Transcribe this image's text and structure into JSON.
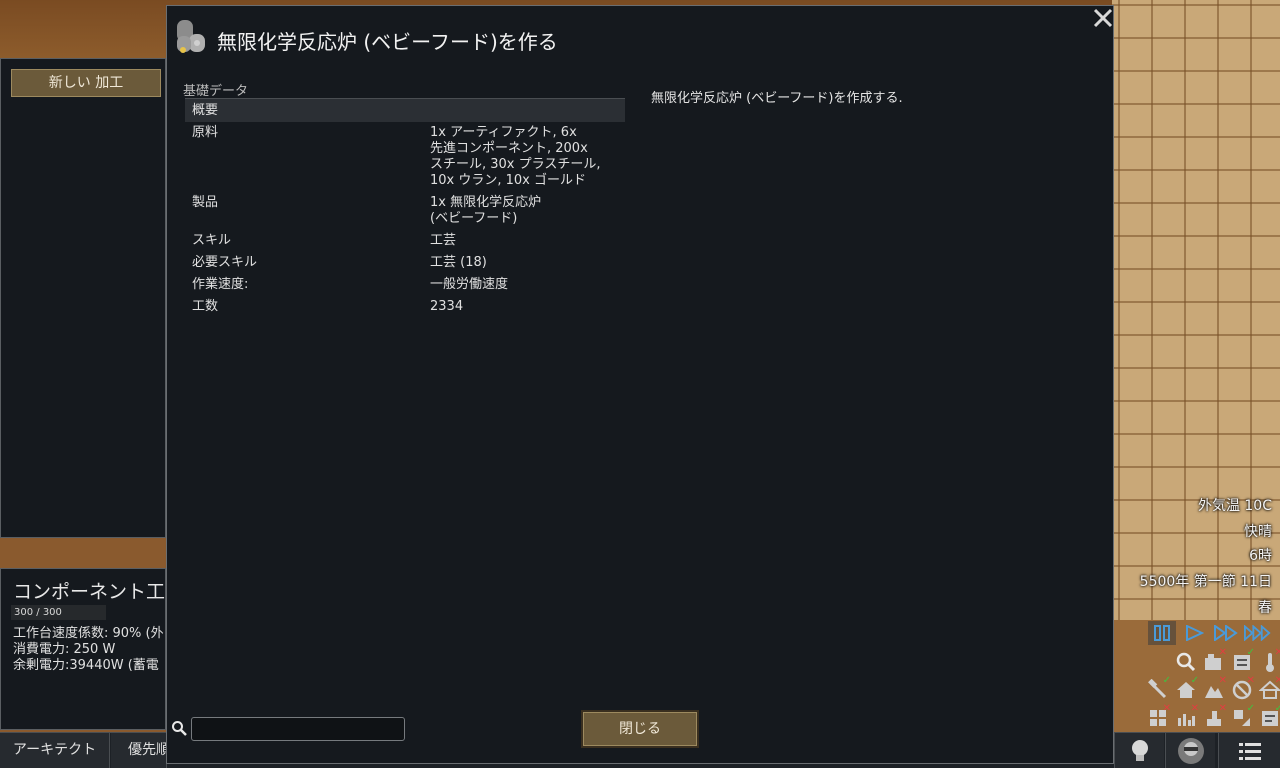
{
  "dialog": {
    "title": "無限化学反応炉 (ベビーフード)を作る",
    "section_label": "基礎データ",
    "summary_header": "概要",
    "stats": [
      {
        "key": "原料",
        "value": "1x アーティファクト, 6x\n先進コンポーネント, 200x\nスチール, 30x プラスチール,\n10x ウラン, 10x ゴールド"
      },
      {
        "key": "製品",
        "value": "1x 無限化学反応炉\n(ベビーフード)"
      },
      {
        "key": "スキル",
        "value": "工芸"
      },
      {
        "key": "必要スキル",
        "value": "工芸 (18)"
      },
      {
        "key": "作業速度:",
        "value": "一般労働速度"
      },
      {
        "key": "工数",
        "value": "2334"
      }
    ],
    "description": "無限化学反応炉 (ベビーフード)を作成する.",
    "search_placeholder": "",
    "close_label": "閉じる"
  },
  "bill_panel": {
    "new_bill_label": "新しい 加工"
  },
  "building_panel": {
    "title": "コンポーネント工",
    "hp": "300 / 300",
    "stats": [
      "工作台速度係数: 90% (外",
      "消費電力: 250 W",
      "余剰電力:39440W (蓄電"
    ]
  },
  "bottom_bar": {
    "tabs": [
      "アーキテクト",
      "優先順"
    ]
  },
  "hud": {
    "outdoor_temp": "外気温 10C",
    "weather": "快晴",
    "time": "6時",
    "date": "5500年 第一節 11日",
    "season": "春"
  },
  "colors": {
    "dialog_bg": "#15191e",
    "button_bg": "#6b5a3a",
    "accent_blue": "#4a9ad8",
    "check_green": "#3fc23f",
    "cross_red": "#e04040"
  }
}
